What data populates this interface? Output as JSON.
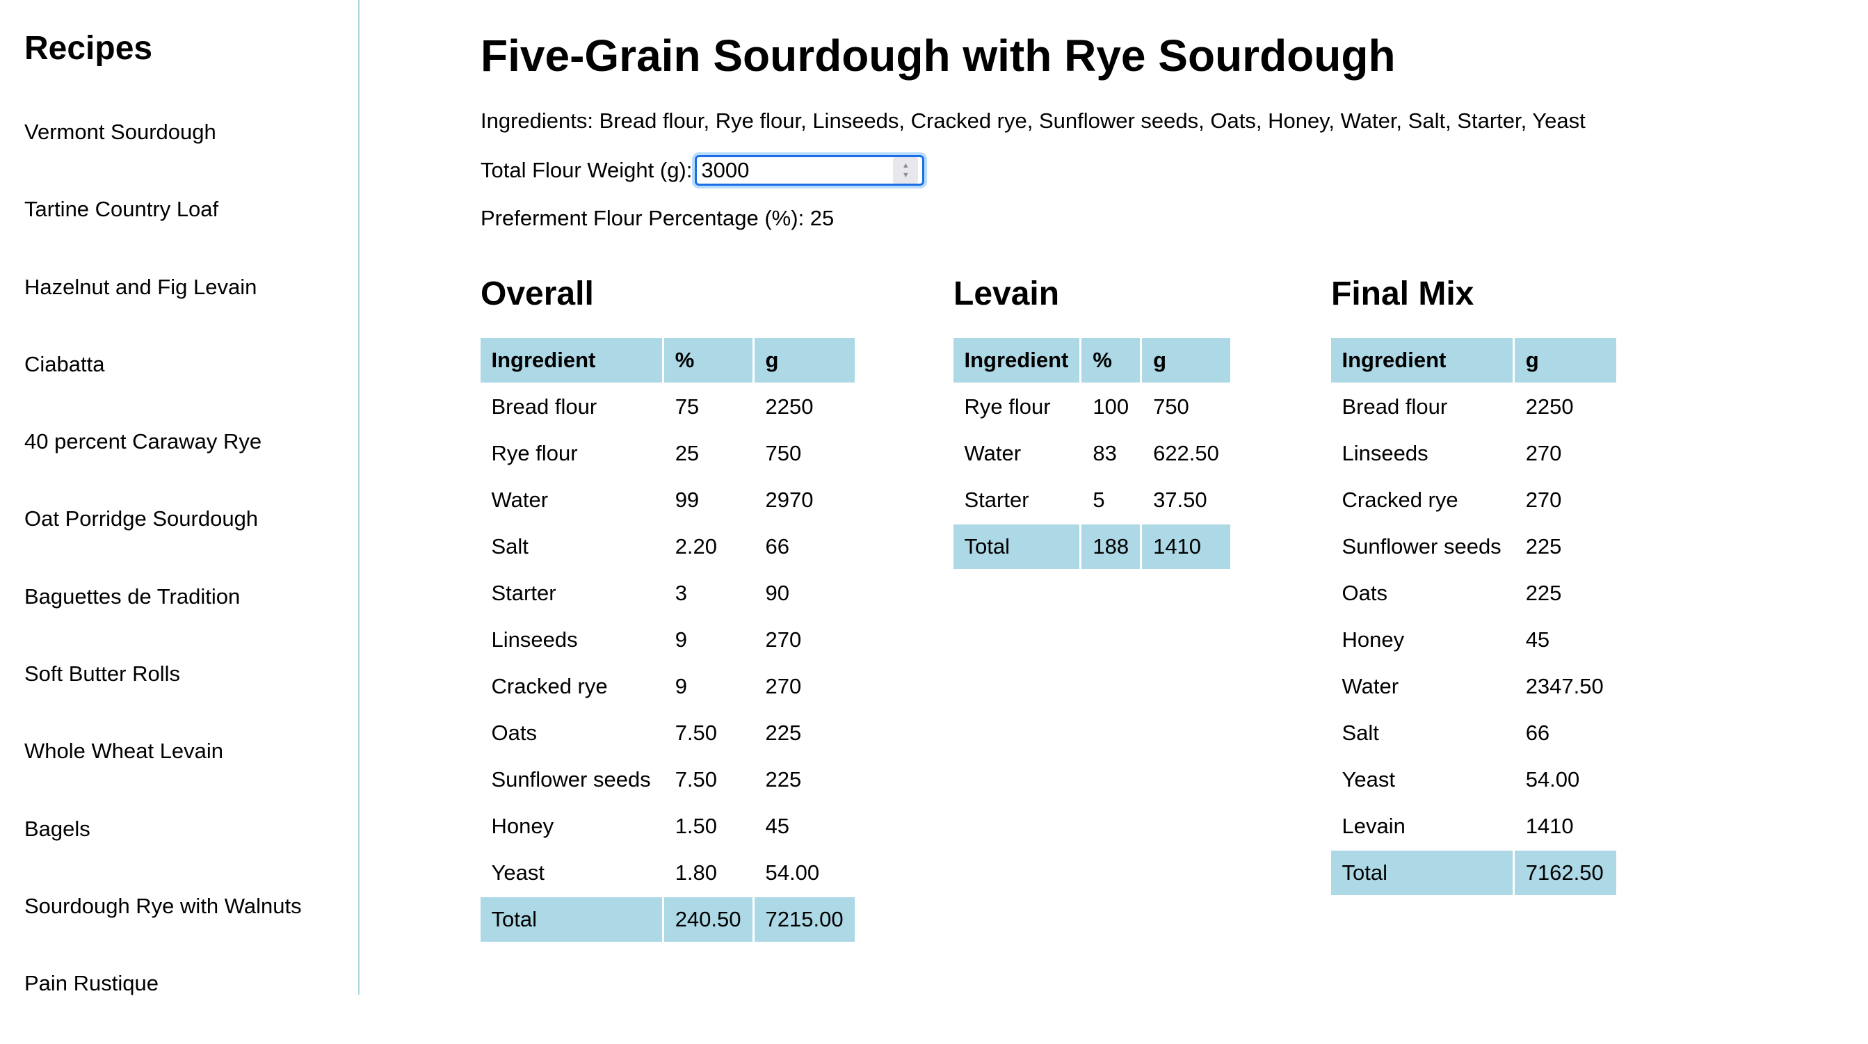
{
  "sidebar": {
    "heading": "Recipes",
    "items": [
      {
        "label": "Vermont Sourdough"
      },
      {
        "label": "Tartine Country Loaf"
      },
      {
        "label": "Hazelnut and Fig Levain"
      },
      {
        "label": "Ciabatta"
      },
      {
        "label": "40 percent Caraway Rye"
      },
      {
        "label": "Oat Porridge Sourdough"
      },
      {
        "label": "Baguettes de Tradition"
      },
      {
        "label": "Soft Butter Rolls"
      },
      {
        "label": "Whole Wheat Levain"
      },
      {
        "label": "Bagels"
      },
      {
        "label": "Sourdough Rye with Walnuts"
      },
      {
        "label": "Pain Rustique"
      }
    ]
  },
  "recipe": {
    "title": "Five-Grain Sourdough with Rye Sourdough",
    "ingredients_text": "Ingredients: Bread flour, Rye flour, Linseeds, Cracked rye, Sunflower seeds, Oats, Honey, Water, Salt, Starter, Yeast",
    "flour_weight_label": "Total Flour Weight (g):",
    "flour_weight_value": "3000",
    "preferment_text": "Preferment Flour Percentage (%): 25",
    "spinner_icons": {
      "up": "▲",
      "down": "▼"
    }
  },
  "overall": {
    "heading": "Overall",
    "columns": [
      "Ingredient",
      "%",
      "g"
    ],
    "rows": [
      [
        "Bread flour",
        "75",
        "2250"
      ],
      [
        "Rye flour",
        "25",
        "750"
      ],
      [
        "Water",
        "99",
        "2970"
      ],
      [
        "Salt",
        "2.20",
        "66"
      ],
      [
        "Starter",
        "3",
        "90"
      ],
      [
        "Linseeds",
        "9",
        "270"
      ],
      [
        "Cracked rye",
        "9",
        "270"
      ],
      [
        "Oats",
        "7.50",
        "225"
      ],
      [
        "Sunflower seeds",
        "7.50",
        "225"
      ],
      [
        "Honey",
        "1.50",
        "45"
      ],
      [
        "Yeast",
        "1.80",
        "54.00"
      ]
    ],
    "total": [
      "Total",
      "240.50",
      "7215.00"
    ]
  },
  "levain": {
    "heading": "Levain",
    "columns": [
      "Ingredient",
      "%",
      "g"
    ],
    "rows": [
      [
        "Rye flour",
        "100",
        "750"
      ],
      [
        "Water",
        "83",
        "622.50"
      ],
      [
        "Starter",
        "5",
        "37.50"
      ]
    ],
    "total": [
      "Total",
      "188",
      "1410"
    ]
  },
  "final_mix": {
    "heading": "Final Mix",
    "columns": [
      "Ingredient",
      "g"
    ],
    "rows": [
      [
        "Bread flour",
        "2250"
      ],
      [
        "Linseeds",
        "270"
      ],
      [
        "Cracked rye",
        "270"
      ],
      [
        "Sunflower seeds",
        "225"
      ],
      [
        "Oats",
        "225"
      ],
      [
        "Honey",
        "45"
      ],
      [
        "Water",
        "2347.50"
      ],
      [
        "Salt",
        "66"
      ],
      [
        "Yeast",
        "54.00"
      ],
      [
        "Levain",
        "1410"
      ]
    ],
    "total": [
      "Total",
      "7162.50"
    ]
  },
  "colors": {
    "accent": "#add8e6",
    "focus": "#1a6fe8"
  }
}
